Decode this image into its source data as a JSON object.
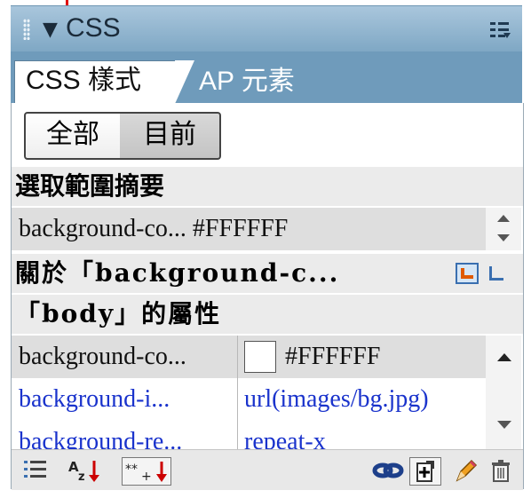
{
  "panel": {
    "title": "CSS",
    "collapse_icon": "triangle-down-icon",
    "menu_icon": "panel-options-icon"
  },
  "tabs": [
    {
      "label": "CSS 樣式",
      "active": true
    },
    {
      "label": "AP 元素",
      "active": false
    }
  ],
  "mode_buttons": {
    "all": "全部",
    "current": "目前",
    "selected": "current"
  },
  "summary": {
    "heading": "選取範圍摘要",
    "row": "background-co... #FFFFFF"
  },
  "about": {
    "heading": "關於「background-c...",
    "icons": [
      "show-cascade-icon",
      "show-information-icon"
    ]
  },
  "properties": {
    "heading": "「body」的屬性",
    "rows": [
      {
        "name": "background-co...",
        "value": "#FFFFFF",
        "swatch": "#FFFFFF",
        "selected": true
      },
      {
        "name": "background-i...",
        "value": "url(images/bg.jpg)",
        "selected": false
      },
      {
        "name": "background-re...",
        "value": "repeat-x",
        "selected": false
      }
    ]
  },
  "toolbar": {
    "left": [
      "category-view-icon",
      "alphabetical-view-icon",
      "set-properties-only-icon"
    ],
    "right": [
      "attach-stylesheet-icon",
      "new-css-rule-icon",
      "edit-style-icon",
      "delete-icon"
    ]
  },
  "colors": {
    "header_bg": "#9fbfd8",
    "tab_bar": "#6f9bbb",
    "property_link": "#1a33cc",
    "callout": "#e00000",
    "section_bg": "#ebebeb"
  }
}
